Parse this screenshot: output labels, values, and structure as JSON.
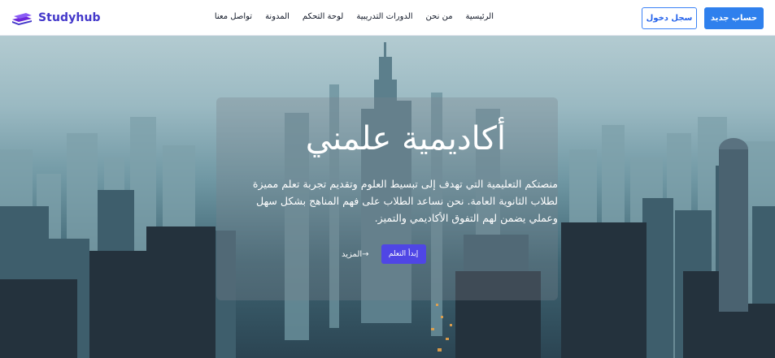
{
  "brand": {
    "name": "Studyhub",
    "icon": "stacked-books-icon",
    "color": "#4338ca"
  },
  "nav": {
    "items": [
      {
        "label": "الرئيسية"
      },
      {
        "label": "من نحن"
      },
      {
        "label": "الدورات التدريبية"
      },
      {
        "label": "لوحة التحكم"
      },
      {
        "label": "المدونة"
      },
      {
        "label": "تواصل معنا"
      }
    ]
  },
  "auth": {
    "login_label": "سجل دخول",
    "register_label": "حساب جديد",
    "accent": "#2f80ed"
  },
  "hero": {
    "title": "أكاديمية علمني",
    "description": "منصتكم التعليمية التي تهدف إلى تبسيط العلوم وتقديم تجربة تعلم مميزة لطلاب الثانوية العامة. نحن نساعد الطلاب على فهم المناهج بشكل سهل وعملي يضمن لهم التفوق الأكاديمي والتميز.",
    "start_label": "إبدأ التعلم",
    "more_label": "المزيد→",
    "button_color": "#4f46e5"
  }
}
